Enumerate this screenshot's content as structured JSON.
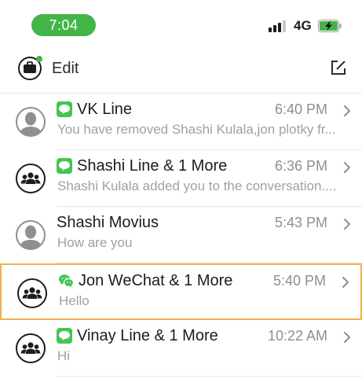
{
  "status_bar": {
    "time": "7:04",
    "network": "4G",
    "colors": {
      "time_pill": "#43b548",
      "battery_fill": "#43b548"
    }
  },
  "header": {
    "edit_label": "Edit"
  },
  "conversations": [
    {
      "title": "VK Line",
      "time": "6:40 PM",
      "preview": "You have removed Shashi Kulala,jon plotky fr...",
      "avatar": "single-person-avatar",
      "channel_icon": "line-icon",
      "selected": false
    },
    {
      "title": "Shashi Line & 1 More",
      "time": "6:36 PM",
      "preview": "Shashi Kulala added you to the conversation....",
      "avatar": "group-avatar",
      "channel_icon": "line-icon",
      "selected": false
    },
    {
      "title": "Shashi Movius",
      "time": "5:43 PM",
      "preview": "How are you",
      "avatar": "single-person-avatar",
      "channel_icon": null,
      "selected": false
    },
    {
      "title": "Jon WeChat & 1 More",
      "time": "5:40 PM",
      "preview": "Hello",
      "avatar": "group-avatar",
      "channel_icon": "wechat-icon",
      "selected": true
    },
    {
      "title": "Vinay Line & 1 More",
      "time": "10:22 AM",
      "preview": "Hi",
      "avatar": "group-avatar",
      "channel_icon": "line-icon",
      "selected": false
    }
  ],
  "colors": {
    "selected_border": "#f0b24a",
    "channel_green": "#44c552",
    "avatar_gray": "#8e8e93"
  }
}
